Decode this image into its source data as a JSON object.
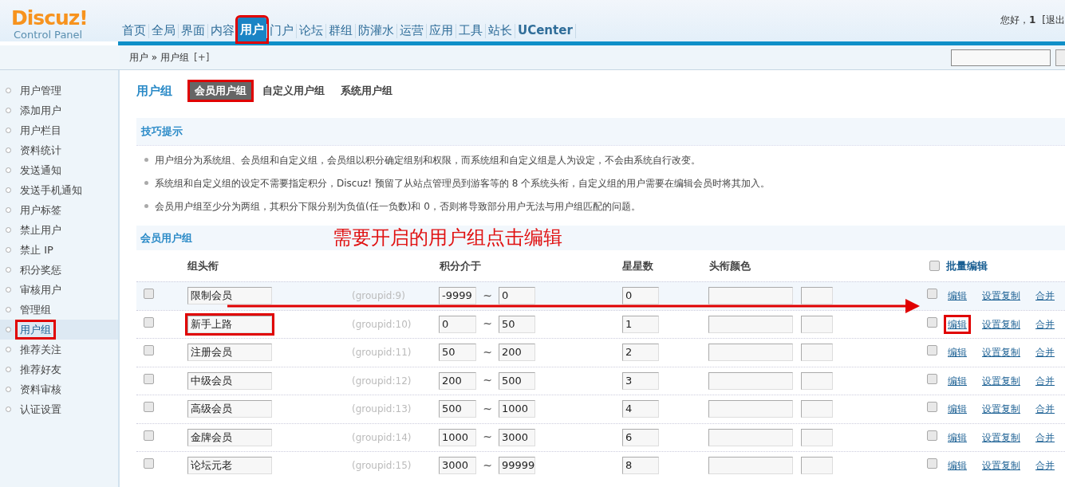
{
  "logo": {
    "title": "Discuz!",
    "subtitle": "Control Panel"
  },
  "nav": [
    {
      "label": "首页",
      "selected": false,
      "highlighted": false
    },
    {
      "label": "全局",
      "selected": false,
      "highlighted": false
    },
    {
      "label": "界面",
      "selected": false,
      "highlighted": false
    },
    {
      "label": "内容",
      "selected": false,
      "highlighted": false
    },
    {
      "label": "用户",
      "selected": true,
      "highlighted": true
    },
    {
      "label": "门户",
      "selected": false,
      "highlighted": false
    },
    {
      "label": "论坛",
      "selected": false,
      "highlighted": false
    },
    {
      "label": "群组",
      "selected": false,
      "highlighted": false
    },
    {
      "label": "防灌水",
      "selected": false,
      "highlighted": false
    },
    {
      "label": "运营",
      "selected": false,
      "highlighted": false
    },
    {
      "label": "应用",
      "selected": false,
      "highlighted": false
    },
    {
      "label": "工具",
      "selected": false,
      "highlighted": false
    },
    {
      "label": "站长",
      "selected": false,
      "highlighted": false
    },
    {
      "label": "UCenter",
      "selected": false,
      "highlighted": false
    }
  ],
  "user": {
    "greeting": "您好，",
    "name": "1",
    "logout": "[退出"
  },
  "breadcrumb": {
    "path": "用户 » 用户组",
    "add": "[+]"
  },
  "sidebar": {
    "items": [
      {
        "label": "用户管理",
        "selected": false,
        "highlighted": false
      },
      {
        "label": "添加用户",
        "selected": false,
        "highlighted": false
      },
      {
        "label": "用户栏目",
        "selected": false,
        "highlighted": false
      },
      {
        "label": "资料统计",
        "selected": false,
        "highlighted": false
      },
      {
        "label": "发送通知",
        "selected": false,
        "highlighted": false
      },
      {
        "label": "发送手机通知",
        "selected": false,
        "highlighted": false
      },
      {
        "label": "用户标签",
        "selected": false,
        "highlighted": false
      },
      {
        "label": "禁止用户",
        "selected": false,
        "highlighted": false
      },
      {
        "label": "禁止 IP",
        "selected": false,
        "highlighted": false
      },
      {
        "label": "积分奖惩",
        "selected": false,
        "highlighted": false
      },
      {
        "label": "审核用户",
        "selected": false,
        "highlighted": false
      },
      {
        "label": "管理组",
        "selected": false,
        "highlighted": false
      },
      {
        "label": "用户组",
        "selected": true,
        "highlighted": true
      },
      {
        "label": "推荐关注",
        "selected": false,
        "highlighted": false
      },
      {
        "label": "推荐好友",
        "selected": false,
        "highlighted": false
      },
      {
        "label": "资料审核",
        "selected": false,
        "highlighted": false
      },
      {
        "label": "认证设置",
        "selected": false,
        "highlighted": false
      }
    ]
  },
  "page_title": "用户组",
  "tabs": [
    {
      "label": "会员用户组",
      "selected": true,
      "highlighted": true
    },
    {
      "label": "自定义用户组",
      "selected": false,
      "highlighted": false
    },
    {
      "label": "系统用户组",
      "selected": false,
      "highlighted": false
    }
  ],
  "tips": {
    "title": "技巧提示",
    "items": [
      "用户组分为系统组、会员组和自定义组，会员组以积分确定组别和权限，而系统组和自定义组是人为设定，不会由系统自行改变。",
      "系统组和自定义组的设定不需要指定积分，Discuz! 预留了从站点管理员到游客等的 8 个系统头衔，自定义组的用户需要在编辑会员时将其加入。",
      "会员用户组至少分为两组，其积分下限分别为负值(任一负数)和 0，否则将导致部分用户无法与用户组匹配的问题。"
    ]
  },
  "section_title": "会员用户组",
  "annotation": "需要开启的用户组点击编辑",
  "columns": [
    "组头衔",
    "积分介于",
    "星星数",
    "头衔颜色"
  ],
  "batch_edit": {
    "label": "批量编辑",
    "checked": false
  },
  "rows": [
    {
      "checked": false,
      "hovered": true,
      "name": "限制会员",
      "name_highlighted": false,
      "groupid": "(groupid:9)",
      "min": "-9999",
      "separator": "~",
      "max": "0",
      "stars": "0",
      "batch": false,
      "actions": [
        {
          "label": "编辑",
          "highlighted": false
        },
        {
          "label": "设置复制",
          "highlighted": false
        },
        {
          "label": "合并",
          "highlighted": false
        }
      ]
    },
    {
      "checked": false,
      "hovered": false,
      "name": "新手上路",
      "name_highlighted": true,
      "groupid": "(groupid:10)",
      "min": "0",
      "separator": "~",
      "max": "50",
      "stars": "1",
      "batch": false,
      "actions": [
        {
          "label": "编辑",
          "highlighted": true
        },
        {
          "label": "设置复制",
          "highlighted": false
        },
        {
          "label": "合并",
          "highlighted": false
        }
      ]
    },
    {
      "checked": false,
      "hovered": false,
      "name": "注册会员",
      "name_highlighted": false,
      "groupid": "(groupid:11)",
      "min": "50",
      "separator": "~",
      "max": "200",
      "stars": "2",
      "batch": false,
      "actions": [
        {
          "label": "编辑",
          "highlighted": false
        },
        {
          "label": "设置复制",
          "highlighted": false
        },
        {
          "label": "合并",
          "highlighted": false
        }
      ]
    },
    {
      "checked": false,
      "hovered": false,
      "name": "中级会员",
      "name_highlighted": false,
      "groupid": "(groupid:12)",
      "min": "200",
      "separator": "~",
      "max": "500",
      "stars": "3",
      "batch": false,
      "actions": [
        {
          "label": "编辑",
          "highlighted": false
        },
        {
          "label": "设置复制",
          "highlighted": false
        },
        {
          "label": "合并",
          "highlighted": false
        }
      ]
    },
    {
      "checked": false,
      "hovered": false,
      "name": "高级会员",
      "name_highlighted": false,
      "groupid": "(groupid:13)",
      "min": "500",
      "separator": "~",
      "max": "1000",
      "stars": "4",
      "batch": false,
      "actions": [
        {
          "label": "编辑",
          "highlighted": false
        },
        {
          "label": "设置复制",
          "highlighted": false
        },
        {
          "label": "合并",
          "highlighted": false
        }
      ]
    },
    {
      "checked": false,
      "hovered": false,
      "name": "金牌会员",
      "name_highlighted": false,
      "groupid": "(groupid:14)",
      "min": "1000",
      "separator": "~",
      "max": "3000",
      "stars": "6",
      "batch": false,
      "actions": [
        {
          "label": "编辑",
          "highlighted": false
        },
        {
          "label": "设置复制",
          "highlighted": false
        },
        {
          "label": "合并",
          "highlighted": false
        }
      ]
    },
    {
      "checked": false,
      "hovered": false,
      "name": "论坛元老",
      "name_highlighted": false,
      "groupid": "(groupid:15)",
      "min": "3000",
      "separator": "~",
      "max": "99999",
      "stars": "8",
      "batch": false,
      "actions": [
        {
          "label": "编辑",
          "highlighted": false
        },
        {
          "label": "设置复制",
          "highlighted": false
        },
        {
          "label": "合并",
          "highlighted": false
        }
      ]
    }
  ]
}
